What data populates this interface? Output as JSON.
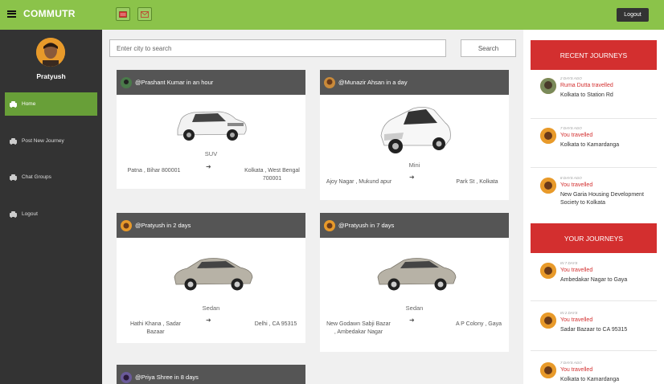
{
  "app": {
    "name": "COMMUTR"
  },
  "header": {
    "logout_label": "Logout",
    "icons": [
      "flag-icon",
      "mail-icon"
    ]
  },
  "sidebar": {
    "user_name": "Pratyush",
    "items": [
      {
        "label": "Home",
        "icon": "home-icon",
        "active": true
      },
      {
        "label": "Post New Journey",
        "icon": "car-icon",
        "active": false
      },
      {
        "label": "Chat Groups",
        "icon": "car-icon",
        "active": false
      },
      {
        "label": "Logout",
        "icon": "car-icon",
        "active": false
      }
    ]
  },
  "search": {
    "placeholder": "Enter city to search",
    "button_label": "Search"
  },
  "feed": [
    {
      "header": "@Prashant Kumar in an hour",
      "car_type": "SUV",
      "from": "Patna , Bihar 800001",
      "to": "Kolkata , West Bengal 700001"
    },
    {
      "header": "@Munazir Ahsan in a day",
      "car_type": "Mini",
      "from": "Ajoy Nagar , Mukund apur",
      "to": "Park St , Kolkata"
    },
    {
      "header": "@Pratyush in 2 days",
      "car_type": "Sedan",
      "from": "Hathi Khana , Sadar Bazaar",
      "to": "Delhi , CA 95315"
    },
    {
      "header": "@Pratyush in 7 days",
      "car_type": "Sedan",
      "from": "New Godawn Sabji Bazar , Ambedakar Nagar",
      "to": "A P Colony , Gaya"
    },
    {
      "header": "@Priya Shree in 8 days"
    }
  ],
  "recent_journeys": {
    "title": "RECENT JOURNEYS",
    "items": [
      {
        "time": "2 DAYS AGO",
        "who": "Ruma Dutta travelled",
        "route": "Kolkata to Station Rd"
      },
      {
        "time": "7 DAYS AGO",
        "who": "You travelled",
        "route": "Kolkata to Kamardanga"
      },
      {
        "time": "8 DAYS AGO",
        "who": "You travelled",
        "route": "New Garia Housing Development Society to Kolkata"
      }
    ]
  },
  "your_journeys": {
    "title": "YOUR JOURNEYS",
    "items": [
      {
        "time": "IN 7 DAYS",
        "who": "You travelled",
        "route": "Ambedakar Nagar to Gaya"
      },
      {
        "time": "IN 2 DAYS",
        "who": "You travelled",
        "route": "Sadar Bazaar to CA 95315"
      },
      {
        "time": "7 DAYS AGO",
        "who": "You travelled",
        "route": "Kolkata to Kamardanga"
      }
    ]
  },
  "colors": {
    "topbar": "#8bc34a",
    "sidebar": "#333333",
    "active": "#689f38",
    "accent_red": "#d32f2f",
    "card_header": "#555555"
  }
}
